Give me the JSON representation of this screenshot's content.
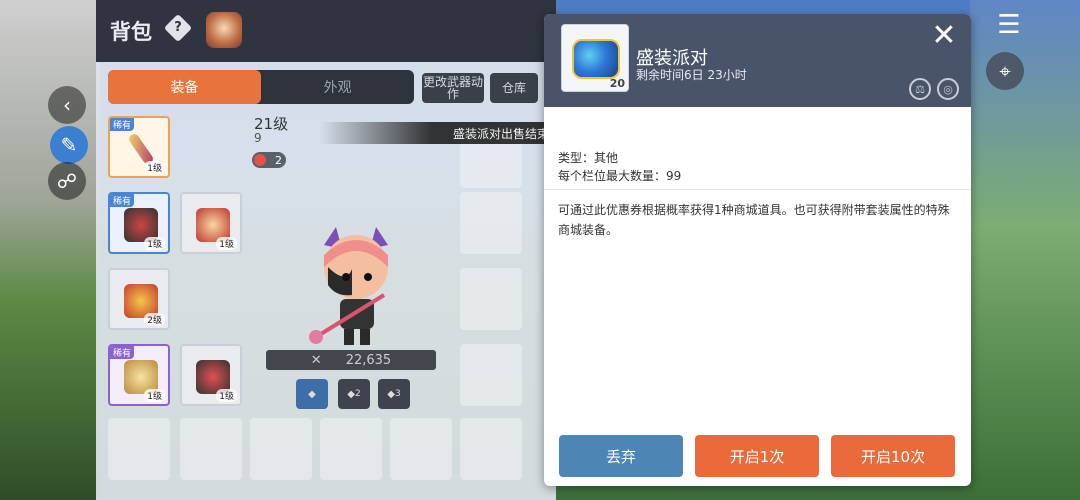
{
  "inventory": {
    "title": "背包",
    "help_icon_text": "?",
    "tabs": [
      {
        "label": "装备",
        "active": true
      },
      {
        "label": "外观",
        "active": false
      }
    ],
    "buttons": {
      "change_weapon_action": "更改武器动作",
      "warehouse": "仓库"
    },
    "character": {
      "level": "21级",
      "level_sub": "9",
      "star_count": "2",
      "combat_power": "22,635"
    },
    "slots": [
      {
        "rarity": "稀有",
        "level": "1级",
        "kind": "weapon"
      },
      {
        "rarity": "稀有",
        "level": "1级",
        "kind": "secondary"
      },
      {
        "rarity": "",
        "level": "1级",
        "kind": "glove"
      },
      {
        "rarity": "",
        "level": "2级",
        "kind": "armor"
      },
      {
        "rarity": "稀有",
        "level": "1级",
        "kind": "hat"
      },
      {
        "rarity": "",
        "level": "1级",
        "kind": "shoes"
      }
    ],
    "presets": [
      "",
      "2",
      "3"
    ]
  },
  "toast": {
    "message": "盛装派对出售结束，无法购买。"
  },
  "item_popup": {
    "name": "盛装派对",
    "remaining_time": "剩余时间6日 23小时",
    "count": "20",
    "type_line": "类型：其他",
    "max_stack_line": "每个栏位最大数量：99",
    "description": "可通过此优惠券根据概率获得1种商城道具。也可获得附带套装属性的特殊商城装备。",
    "buttons": {
      "discard": "丢弃",
      "open_once": "开启1次",
      "open_ten": "开启10次"
    }
  },
  "colors": {
    "accent_orange": "#ea6a3c",
    "discard_blue": "#4b86b4",
    "popup_header": "#48546a"
  }
}
